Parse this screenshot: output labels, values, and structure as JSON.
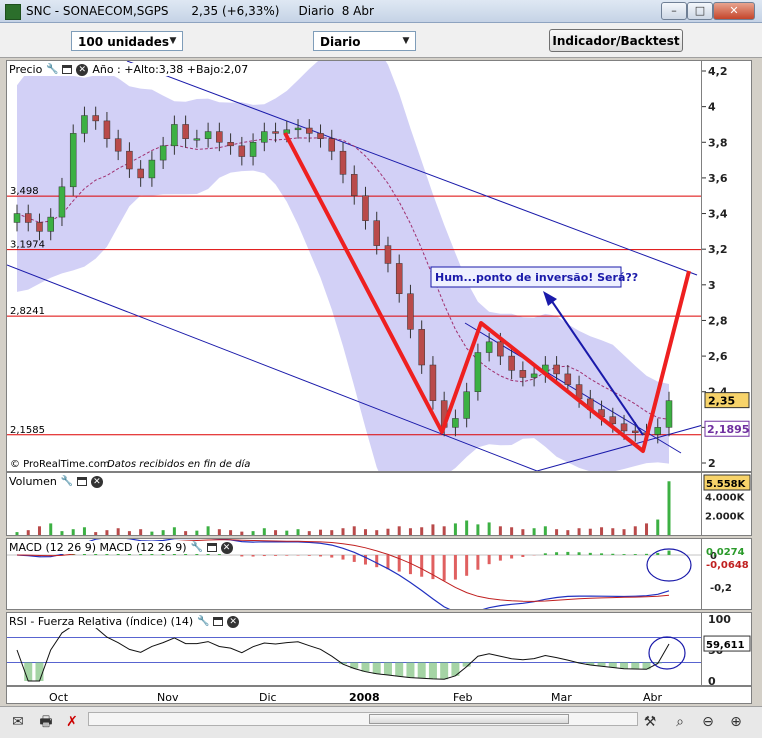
{
  "window": {
    "title": "SNC - SONAECOM,SGPS      2,35 (+6,33%)     Diario  8 Abr",
    "minimize_glyph": "–",
    "maximize_glyph": "□",
    "close_glyph": "✕"
  },
  "toolbar": {
    "units_select": "100 unidades",
    "period_select": "Diario",
    "indicator_button": "Indicador/Backtest"
  },
  "price_panel": {
    "title": "Precio",
    "stats": "Año : +Alto:3,38 +Bajo:2,07",
    "annotation": "Hum...ponto de inversão! Será??",
    "footer_source": "© ProRealTime.com",
    "footer_note": "Datos recibidos en fin de día",
    "axis_ticks": [
      "4,2",
      "4",
      "3,8",
      "3,6",
      "3,4",
      "3,2",
      "3",
      "2,8",
      "2,6",
      "2,4",
      "2,2",
      "2"
    ],
    "current_price_label": "2,35",
    "ma_value_label": "2,1895",
    "colors": {
      "candle_up": "#3cb043",
      "candle_down": "#b94a4a",
      "band_fill": "#b4b0f0",
      "hline": "#dd0000",
      "trendline": "#1a1aaa",
      "red_path": "#ee2020"
    }
  },
  "volume_panel": {
    "title": "Volumen",
    "axis_ticks": [
      "4.000K",
      "2.000K"
    ],
    "last_value_label": "5.558K"
  },
  "macd_panel": {
    "title": "MACD (12 26 9) MACD (12 26 9)",
    "axis_ticks": [
      "0",
      "-0,2"
    ],
    "value_label_1": "0,0274",
    "value_label_2": "-0,0648"
  },
  "rsi_panel": {
    "title": "RSI - Fuerza Relativa (índice) (14)",
    "axis_ticks": [
      "100",
      "50",
      "0"
    ],
    "value_label": "59,611"
  },
  "x_axis": {
    "labels": [
      "Oct",
      "Nov",
      "Dic",
      "2008",
      "Feb",
      "Mar",
      "Abr"
    ]
  },
  "chart_data": {
    "type": "candlestick",
    "title": "SNC - SONAECOM,SGPS",
    "timeframe": "Diario",
    "last_price": 2.35,
    "change_pct": 6.33,
    "year_high": 3.38,
    "year_low": 2.07,
    "ylim": [
      2.0,
      4.2
    ],
    "horizontal_lines": [
      3.498,
      3.1974,
      2.8241,
      2.1585
    ],
    "x_labels": [
      "Oct",
      "Nov",
      "Dic",
      "2008",
      "Feb",
      "Mar",
      "Abr"
    ],
    "price_path_close": [
      3.4,
      3.35,
      3.3,
      3.38,
      3.55,
      3.85,
      3.95,
      3.92,
      3.82,
      3.75,
      3.65,
      3.6,
      3.7,
      3.78,
      3.9,
      3.82,
      3.82,
      3.86,
      3.8,
      3.78,
      3.72,
      3.8,
      3.86,
      3.85,
      3.87,
      3.88,
      3.85,
      3.82,
      3.75,
      3.62,
      3.5,
      3.36,
      3.22,
      3.12,
      2.95,
      2.75,
      2.55,
      2.35,
      2.2,
      2.25,
      2.4,
      2.62,
      2.68,
      2.6,
      2.52,
      2.48,
      2.5,
      2.55,
      2.5,
      2.44,
      2.36,
      2.3,
      2.26,
      2.22,
      2.18,
      2.17,
      2.16,
      2.2,
      2.35
    ],
    "volume_k": [
      300,
      500,
      900,
      1200,
      400,
      600,
      800,
      300,
      500,
      700,
      400,
      600,
      350,
      500,
      800,
      400,
      450,
      900,
      600,
      500,
      350,
      400,
      700,
      500,
      450,
      600,
      400,
      550,
      500,
      700,
      900,
      600,
      500,
      650,
      900,
      700,
      800,
      1100,
      900,
      1200,
      1500,
      1100,
      1300,
      900,
      800,
      600,
      700,
      900,
      600,
      500,
      700,
      650,
      800,
      700,
      600,
      900,
      1200,
      1600,
      5558
    ],
    "macd_last": 0.0274,
    "macd_signal_last": -0.0648,
    "rsi_last": 59.611
  }
}
